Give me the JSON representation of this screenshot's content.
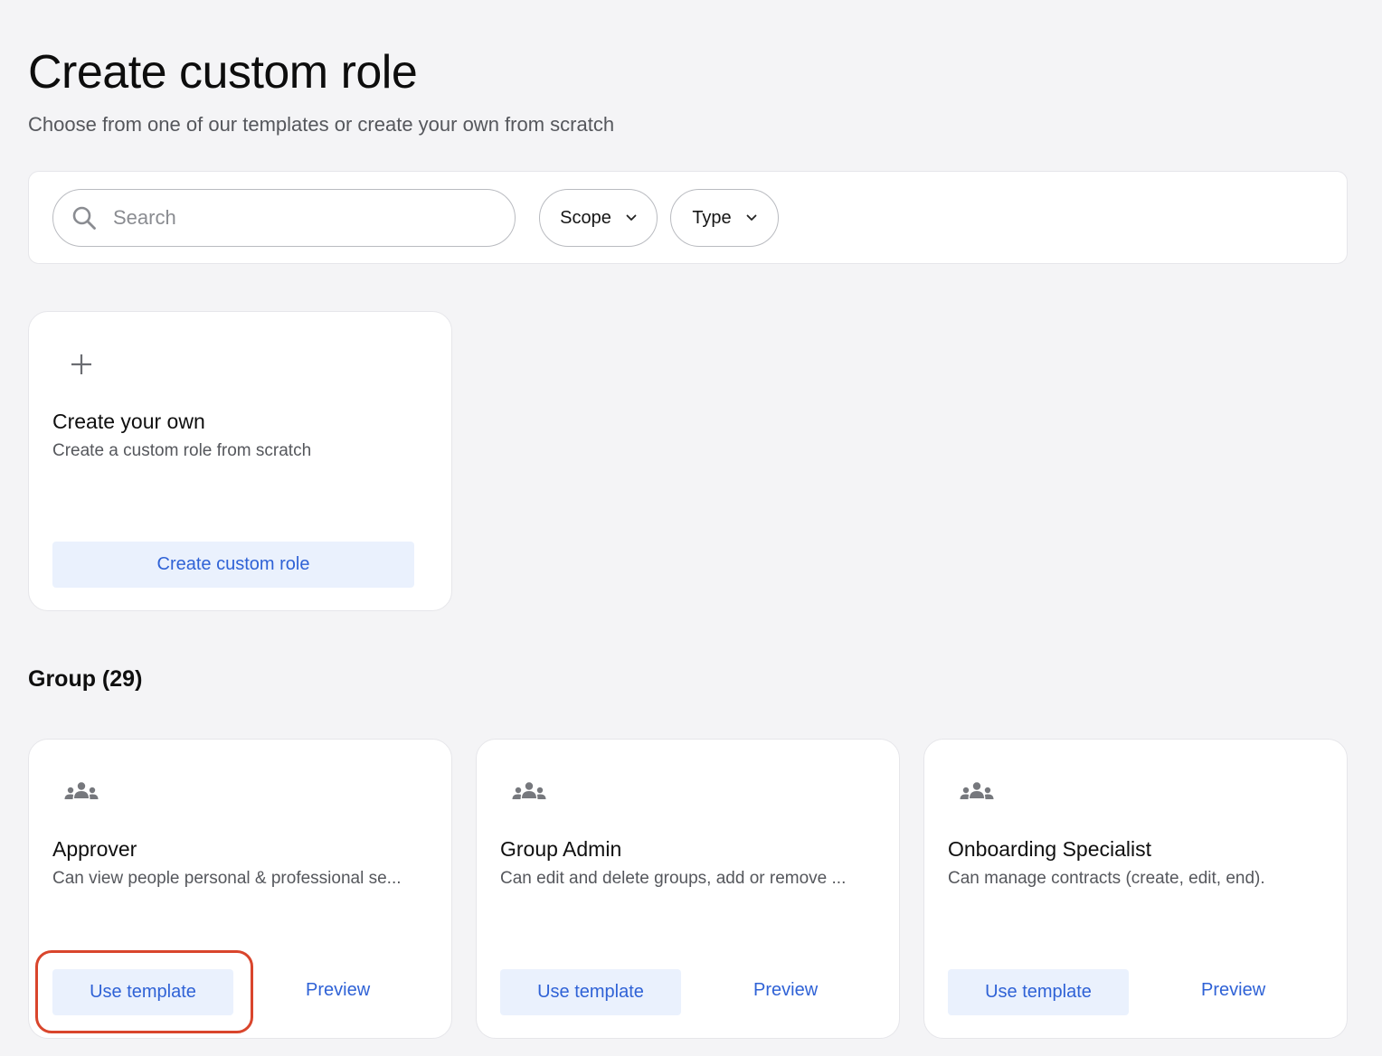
{
  "header": {
    "title": "Create custom role",
    "subtitle": "Choose from one of our templates or create your own from scratch"
  },
  "filters": {
    "search": {
      "placeholder": "Search",
      "value": "",
      "icon": "search-icon"
    },
    "scope_label": "Scope",
    "type_label": "Type"
  },
  "create_card": {
    "icon": "plus-icon",
    "title": "Create your own",
    "description": "Create a custom role from scratch",
    "button_label": "Create custom role"
  },
  "group_section": {
    "title": "Group (29)",
    "templates": [
      {
        "icon": "group-icon",
        "title": "Approver",
        "description": "Can view people personal & professional se...",
        "use_label": "Use template",
        "preview_label": "Preview"
      },
      {
        "icon": "group-icon",
        "title": "Group Admin",
        "description": "Can edit and delete groups, add or remove ...",
        "use_label": "Use template",
        "preview_label": "Preview"
      },
      {
        "icon": "group-icon",
        "title": "Onboarding Specialist",
        "description": "Can manage contracts (create, edit, end).",
        "use_label": "Use template",
        "preview_label": "Preview"
      }
    ]
  },
  "colors": {
    "accent": "#2f62d6",
    "button_bg": "#eaf1fd",
    "highlight": "#d9452c",
    "background": "#f4f4f6"
  }
}
